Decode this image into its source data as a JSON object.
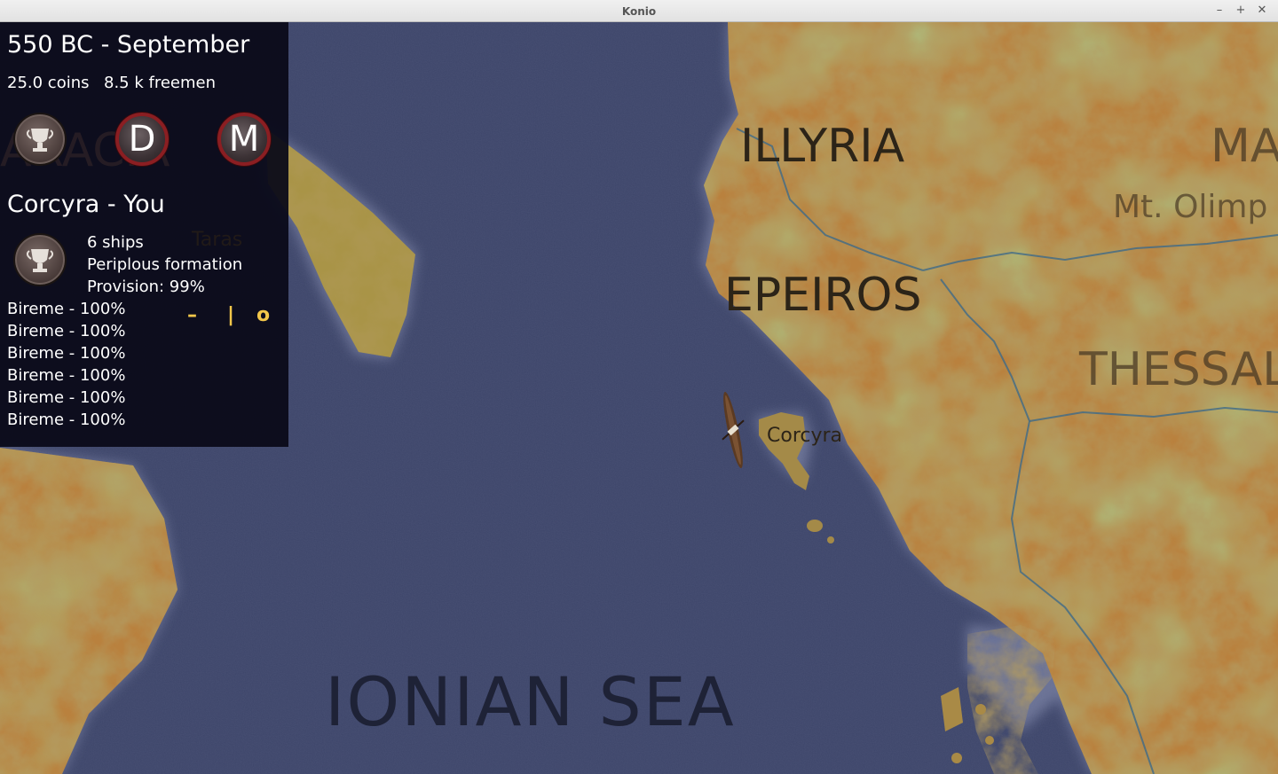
{
  "window": {
    "title": "Konio",
    "minimize": "–",
    "maximize": "+",
    "close": "✕"
  },
  "status": {
    "date": "550 BC - September",
    "coins": "25.0 coins",
    "freemen": "8.5 k freemen"
  },
  "advisors": [
    {
      "icon": "trophy-icon"
    },
    {
      "letter": "D"
    },
    {
      "letter": "M"
    }
  ],
  "fleet": {
    "title": "Corcyra - You",
    "icon": "trophy-icon",
    "ships": "6 ships",
    "formation": "Periplous formation",
    "provision": "Provision: 99%",
    "units": [
      "Bireme - 100%",
      "Bireme - 100%",
      "Bireme - 100%",
      "Bireme - 100%",
      "Bireme - 100%",
      "Bireme - 100%"
    ],
    "formation_controls": [
      "–",
      "|",
      "o"
    ]
  },
  "map": {
    "sea": "IONIAN SEA",
    "regions": [
      "ILLYRIA",
      "EPEIROS",
      "THESSAL",
      "MA"
    ],
    "places": [
      "Mt. Olimp",
      "Corcyra",
      "Taras"
    ],
    "partial_region": "ARACIA"
  },
  "colors": {
    "sea": "#3d4569",
    "land": "#b9813e",
    "panel": "#0a0a18",
    "accent": "#f2c64a",
    "badge_ring": "#8b1e22"
  }
}
